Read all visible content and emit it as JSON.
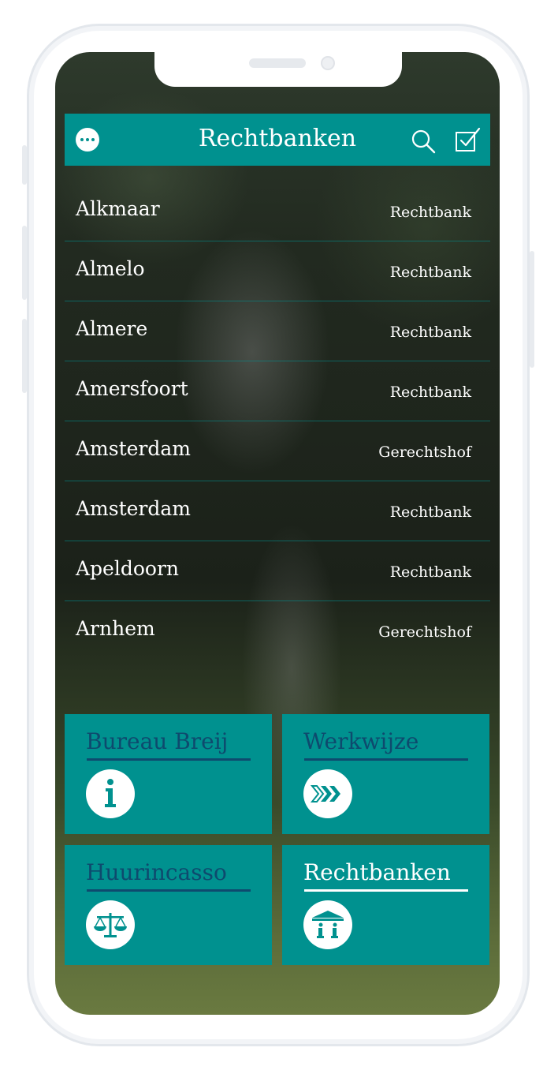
{
  "header": {
    "title": "Rechtbanken",
    "menu_icon": "more-dots-icon",
    "search_icon": "search-icon",
    "select_icon": "checkbox-select-icon"
  },
  "courts": [
    {
      "name": "Alkmaar",
      "type": "Rechtbank"
    },
    {
      "name": "Almelo",
      "type": "Rechtbank"
    },
    {
      "name": "Almere",
      "type": "Rechtbank"
    },
    {
      "name": "Amersfoort",
      "type": "Rechtbank"
    },
    {
      "name": "Amsterdam",
      "type": "Gerechtshof"
    },
    {
      "name": "Amsterdam",
      "type": "Rechtbank"
    },
    {
      "name": "Apeldoorn",
      "type": "Rechtbank"
    },
    {
      "name": "Arnhem",
      "type": "Gerechtshof"
    }
  ],
  "tiles": [
    {
      "label": "Bureau Breij",
      "icon": "info-icon",
      "active": false
    },
    {
      "label": "Werkwijze",
      "icon": "chevrons-forward-icon",
      "active": false
    },
    {
      "label": "Huurincasso",
      "icon": "scales-icon",
      "active": false
    },
    {
      "label": "Rechtbanken",
      "icon": "courthouse-icon",
      "active": true
    }
  ],
  "colors": {
    "accent": "#00918f",
    "tile_text": "#0e4a6e",
    "row_divider": "#009696"
  }
}
